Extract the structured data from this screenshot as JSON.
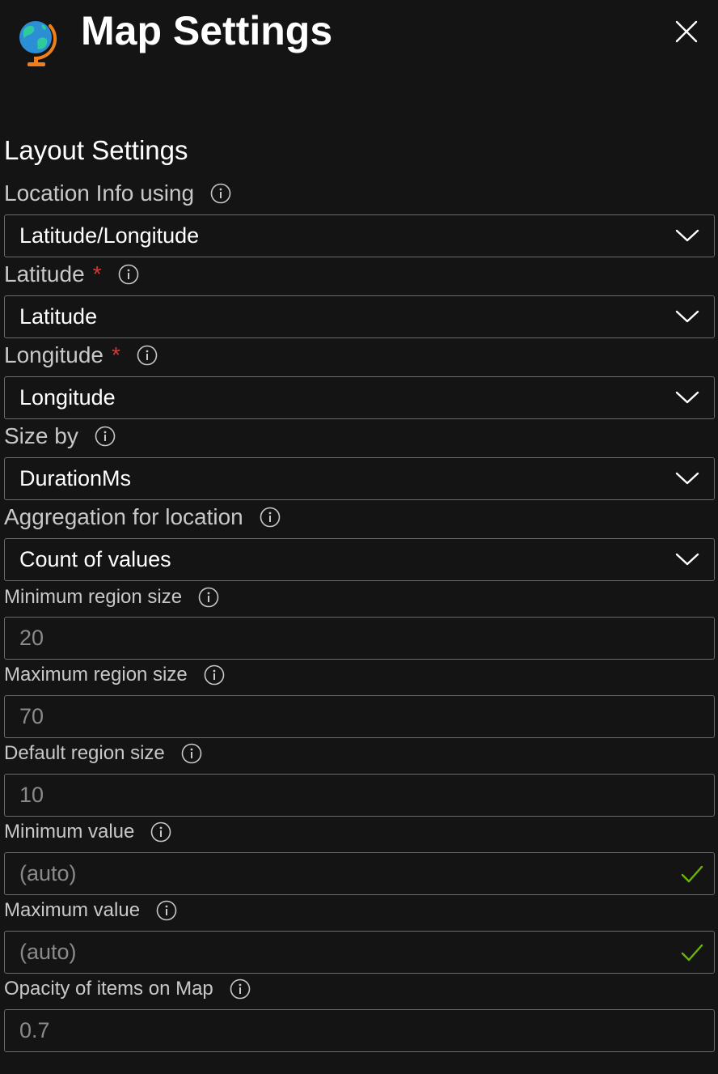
{
  "header": {
    "title": "Map Settings",
    "icon": "globe-icon"
  },
  "section": {
    "title": "Layout Settings"
  },
  "fields": {
    "location_info": {
      "label": "Location Info using",
      "value": "Latitude/Longitude"
    },
    "latitude": {
      "label": "Latitude",
      "required": "*",
      "value": "Latitude"
    },
    "longitude": {
      "label": "Longitude",
      "required": "*",
      "value": "Longitude"
    },
    "size_by": {
      "label": "Size by",
      "value": "DurationMs"
    },
    "aggregation": {
      "label": "Aggregation for location",
      "value": "Count of values"
    },
    "min_region_size": {
      "label": "Minimum region size",
      "value": "20"
    },
    "max_region_size": {
      "label": "Maximum region size",
      "value": "70"
    },
    "default_region_size": {
      "label": "Default region size",
      "value": "10"
    },
    "min_value": {
      "label": "Minimum value",
      "value": "(auto)"
    },
    "max_value": {
      "label": "Maximum value",
      "value": "(auto)"
    },
    "opacity": {
      "label": "Opacity of items on Map",
      "value": "0.7"
    }
  },
  "colors": {
    "background": "#141414",
    "border": "#6b6b6b",
    "required": "#e0342f",
    "valid_check": "#6bb700",
    "globe_ocean": "#2c8fd6",
    "globe_land": "#2ecc9a",
    "globe_stand": "#f07f1b"
  }
}
